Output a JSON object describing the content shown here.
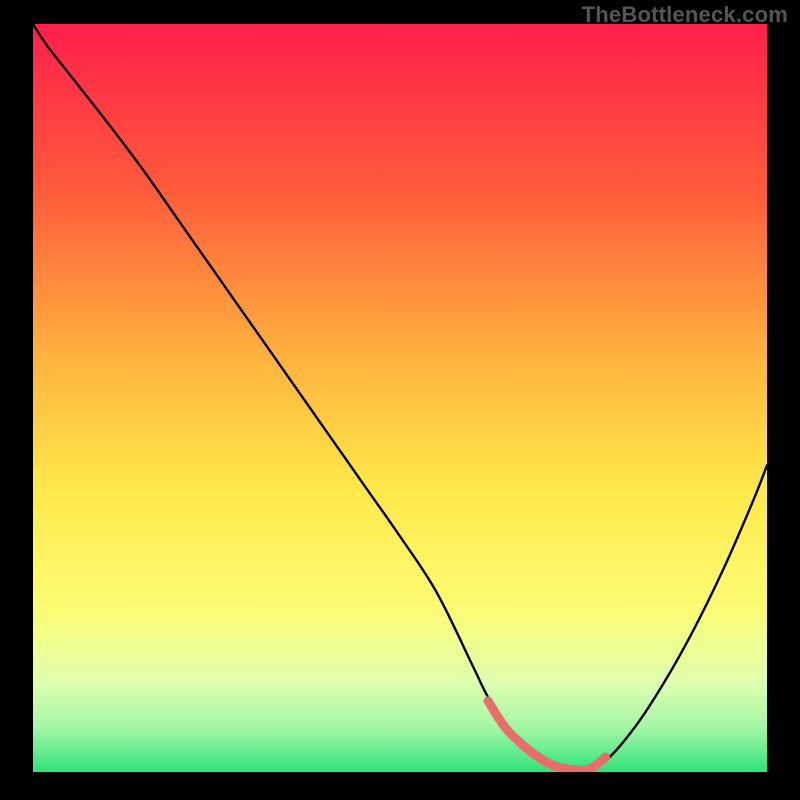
{
  "watermark": "TheBottleneck.com",
  "chart_data": {
    "type": "line",
    "title": "",
    "xlabel": "",
    "ylabel": "",
    "xlim": [
      0,
      100
    ],
    "ylim": [
      0,
      100
    ],
    "gradient_stops": [
      {
        "offset": 0,
        "color": "#ff1f4b"
      },
      {
        "offset": 22,
        "color": "#ff5a3c"
      },
      {
        "offset": 45,
        "color": "#ffb43e"
      },
      {
        "offset": 62,
        "color": "#ffe84a"
      },
      {
        "offset": 78,
        "color": "#fdfc73"
      },
      {
        "offset": 88,
        "color": "#dfffb0"
      },
      {
        "offset": 94,
        "color": "#a4f7a6"
      },
      {
        "offset": 100,
        "color": "#2fe37a"
      }
    ],
    "series": [
      {
        "name": "main-curve",
        "color": "#000000",
        "x": [
          0,
          2,
          6,
          10,
          15,
          20,
          25,
          30,
          35,
          40,
          45,
          50,
          55,
          60,
          62,
          65,
          70,
          73,
          75,
          78,
          82,
          86,
          90,
          94,
          98,
          100
        ],
        "y": [
          100,
          97,
          92,
          87,
          80.5,
          73.5,
          66.5,
          59.5,
          52.5,
          45.5,
          38.5,
          31.5,
          24,
          14,
          10,
          5.5,
          1.5,
          0.3,
          0.3,
          1.5,
          6,
          12,
          19,
          27,
          36,
          41
        ]
      },
      {
        "name": "highlight-segment",
        "color": "#e86d6d",
        "x": [
          62,
          65,
          70,
          74,
          76,
          78
        ],
        "y": [
          9.5,
          5.2,
          1.3,
          0.3,
          0.5,
          2.0
        ]
      }
    ]
  }
}
